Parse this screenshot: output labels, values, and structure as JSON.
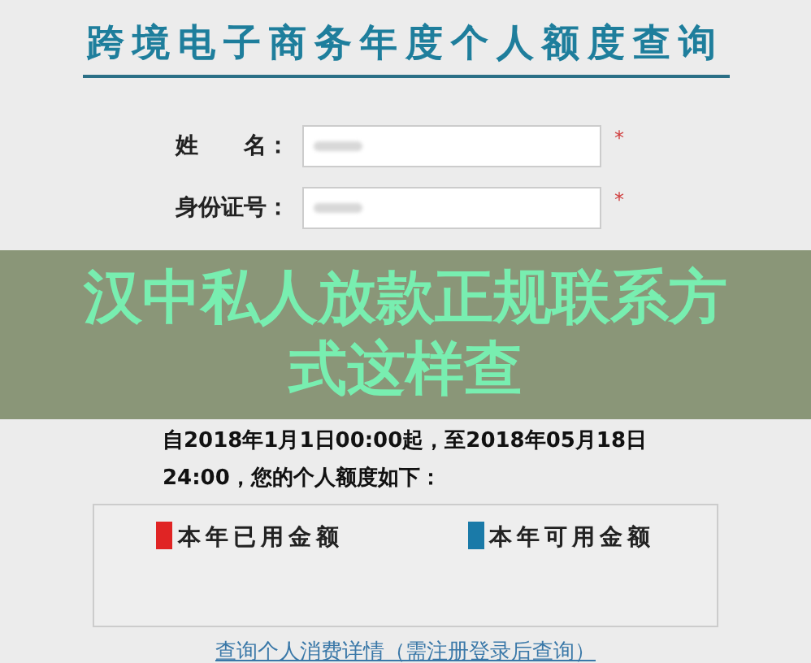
{
  "title": "跨境电子商务年度个人额度查询",
  "fields": [
    {
      "label": "姓　　名：",
      "mark": "*"
    },
    {
      "label": "身份证号：",
      "mark": "*"
    }
  ],
  "overlay_banner": "汉中私人放款正规联系方式这样查",
  "result_text": "自2018年1月1日00:00起，至2018年05月18日24:00，您的个人额度如下：",
  "legend": [
    {
      "label": "本年已用金额",
      "color": "#e02424"
    },
    {
      "label": "本年可用金额",
      "color": "#1a7aa8"
    }
  ],
  "link": "查询个人消费详情（需注册登录后查询）"
}
